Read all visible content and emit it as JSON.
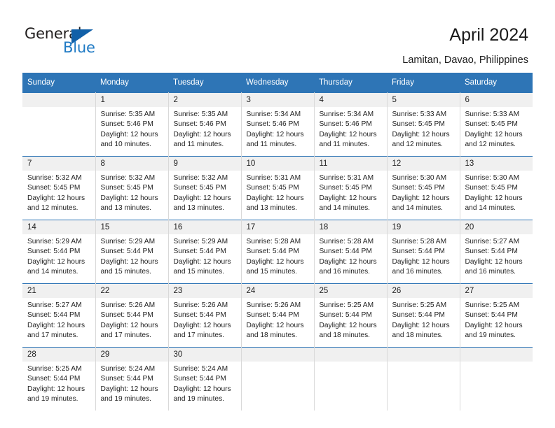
{
  "brand": {
    "name_part1": "General",
    "name_part2": "Blue",
    "triangle_color": "#1160a8"
  },
  "header": {
    "title": "April 2024",
    "subtitle": "Lamitan, Davao, Philippines"
  },
  "theme": {
    "header_blue": "#2e75b6",
    "daynum_band": "#f0f0f0",
    "grid_line": "#d9d9d9"
  },
  "calendar": {
    "weekday_headers": [
      "Sunday",
      "Monday",
      "Tuesday",
      "Wednesday",
      "Thursday",
      "Friday",
      "Saturday"
    ],
    "labels": {
      "sunrise": "Sunrise:",
      "sunset": "Sunset:",
      "daylight": "Daylight:"
    },
    "weeks": [
      [
        {
          "day": "",
          "empty": true,
          "sunrise": "",
          "sunset": "",
          "daylight_line1": "",
          "daylight_line2": ""
        },
        {
          "day": "1",
          "sunrise": "Sunrise: 5:35 AM",
          "sunset": "Sunset: 5:46 PM",
          "daylight_line1": "Daylight: 12 hours",
          "daylight_line2": "and 10 minutes."
        },
        {
          "day": "2",
          "sunrise": "Sunrise: 5:35 AM",
          "sunset": "Sunset: 5:46 PM",
          "daylight_line1": "Daylight: 12 hours",
          "daylight_line2": "and 11 minutes."
        },
        {
          "day": "3",
          "sunrise": "Sunrise: 5:34 AM",
          "sunset": "Sunset: 5:46 PM",
          "daylight_line1": "Daylight: 12 hours",
          "daylight_line2": "and 11 minutes."
        },
        {
          "day": "4",
          "sunrise": "Sunrise: 5:34 AM",
          "sunset": "Sunset: 5:46 PM",
          "daylight_line1": "Daylight: 12 hours",
          "daylight_line2": "and 11 minutes."
        },
        {
          "day": "5",
          "sunrise": "Sunrise: 5:33 AM",
          "sunset": "Sunset: 5:45 PM",
          "daylight_line1": "Daylight: 12 hours",
          "daylight_line2": "and 12 minutes."
        },
        {
          "day": "6",
          "sunrise": "Sunrise: 5:33 AM",
          "sunset": "Sunset: 5:45 PM",
          "daylight_line1": "Daylight: 12 hours",
          "daylight_line2": "and 12 minutes."
        }
      ],
      [
        {
          "day": "7",
          "sunrise": "Sunrise: 5:32 AM",
          "sunset": "Sunset: 5:45 PM",
          "daylight_line1": "Daylight: 12 hours",
          "daylight_line2": "and 12 minutes."
        },
        {
          "day": "8",
          "sunrise": "Sunrise: 5:32 AM",
          "sunset": "Sunset: 5:45 PM",
          "daylight_line1": "Daylight: 12 hours",
          "daylight_line2": "and 13 minutes."
        },
        {
          "day": "9",
          "sunrise": "Sunrise: 5:32 AM",
          "sunset": "Sunset: 5:45 PM",
          "daylight_line1": "Daylight: 12 hours",
          "daylight_line2": "and 13 minutes."
        },
        {
          "day": "10",
          "sunrise": "Sunrise: 5:31 AM",
          "sunset": "Sunset: 5:45 PM",
          "daylight_line1": "Daylight: 12 hours",
          "daylight_line2": "and 13 minutes."
        },
        {
          "day": "11",
          "sunrise": "Sunrise: 5:31 AM",
          "sunset": "Sunset: 5:45 PM",
          "daylight_line1": "Daylight: 12 hours",
          "daylight_line2": "and 14 minutes."
        },
        {
          "day": "12",
          "sunrise": "Sunrise: 5:30 AM",
          "sunset": "Sunset: 5:45 PM",
          "daylight_line1": "Daylight: 12 hours",
          "daylight_line2": "and 14 minutes."
        },
        {
          "day": "13",
          "sunrise": "Sunrise: 5:30 AM",
          "sunset": "Sunset: 5:45 PM",
          "daylight_line1": "Daylight: 12 hours",
          "daylight_line2": "and 14 minutes."
        }
      ],
      [
        {
          "day": "14",
          "sunrise": "Sunrise: 5:29 AM",
          "sunset": "Sunset: 5:44 PM",
          "daylight_line1": "Daylight: 12 hours",
          "daylight_line2": "and 14 minutes."
        },
        {
          "day": "15",
          "sunrise": "Sunrise: 5:29 AM",
          "sunset": "Sunset: 5:44 PM",
          "daylight_line1": "Daylight: 12 hours",
          "daylight_line2": "and 15 minutes."
        },
        {
          "day": "16",
          "sunrise": "Sunrise: 5:29 AM",
          "sunset": "Sunset: 5:44 PM",
          "daylight_line1": "Daylight: 12 hours",
          "daylight_line2": "and 15 minutes."
        },
        {
          "day": "17",
          "sunrise": "Sunrise: 5:28 AM",
          "sunset": "Sunset: 5:44 PM",
          "daylight_line1": "Daylight: 12 hours",
          "daylight_line2": "and 15 minutes."
        },
        {
          "day": "18",
          "sunrise": "Sunrise: 5:28 AM",
          "sunset": "Sunset: 5:44 PM",
          "daylight_line1": "Daylight: 12 hours",
          "daylight_line2": "and 16 minutes."
        },
        {
          "day": "19",
          "sunrise": "Sunrise: 5:28 AM",
          "sunset": "Sunset: 5:44 PM",
          "daylight_line1": "Daylight: 12 hours",
          "daylight_line2": "and 16 minutes."
        },
        {
          "day": "20",
          "sunrise": "Sunrise: 5:27 AM",
          "sunset": "Sunset: 5:44 PM",
          "daylight_line1": "Daylight: 12 hours",
          "daylight_line2": "and 16 minutes."
        }
      ],
      [
        {
          "day": "21",
          "sunrise": "Sunrise: 5:27 AM",
          "sunset": "Sunset: 5:44 PM",
          "daylight_line1": "Daylight: 12 hours",
          "daylight_line2": "and 17 minutes."
        },
        {
          "day": "22",
          "sunrise": "Sunrise: 5:26 AM",
          "sunset": "Sunset: 5:44 PM",
          "daylight_line1": "Daylight: 12 hours",
          "daylight_line2": "and 17 minutes."
        },
        {
          "day": "23",
          "sunrise": "Sunrise: 5:26 AM",
          "sunset": "Sunset: 5:44 PM",
          "daylight_line1": "Daylight: 12 hours",
          "daylight_line2": "and 17 minutes."
        },
        {
          "day": "24",
          "sunrise": "Sunrise: 5:26 AM",
          "sunset": "Sunset: 5:44 PM",
          "daylight_line1": "Daylight: 12 hours",
          "daylight_line2": "and 18 minutes."
        },
        {
          "day": "25",
          "sunrise": "Sunrise: 5:25 AM",
          "sunset": "Sunset: 5:44 PM",
          "daylight_line1": "Daylight: 12 hours",
          "daylight_line2": "and 18 minutes."
        },
        {
          "day": "26",
          "sunrise": "Sunrise: 5:25 AM",
          "sunset": "Sunset: 5:44 PM",
          "daylight_line1": "Daylight: 12 hours",
          "daylight_line2": "and 18 minutes."
        },
        {
          "day": "27",
          "sunrise": "Sunrise: 5:25 AM",
          "sunset": "Sunset: 5:44 PM",
          "daylight_line1": "Daylight: 12 hours",
          "daylight_line2": "and 19 minutes."
        }
      ],
      [
        {
          "day": "28",
          "sunrise": "Sunrise: 5:25 AM",
          "sunset": "Sunset: 5:44 PM",
          "daylight_line1": "Daylight: 12 hours",
          "daylight_line2": "and 19 minutes."
        },
        {
          "day": "29",
          "sunrise": "Sunrise: 5:24 AM",
          "sunset": "Sunset: 5:44 PM",
          "daylight_line1": "Daylight: 12 hours",
          "daylight_line2": "and 19 minutes."
        },
        {
          "day": "30",
          "sunrise": "Sunrise: 5:24 AM",
          "sunset": "Sunset: 5:44 PM",
          "daylight_line1": "Daylight: 12 hours",
          "daylight_line2": "and 19 minutes."
        },
        {
          "day": "",
          "empty": true,
          "sunrise": "",
          "sunset": "",
          "daylight_line1": "",
          "daylight_line2": ""
        },
        {
          "day": "",
          "empty": true,
          "sunrise": "",
          "sunset": "",
          "daylight_line1": "",
          "daylight_line2": ""
        },
        {
          "day": "",
          "empty": true,
          "sunrise": "",
          "sunset": "",
          "daylight_line1": "",
          "daylight_line2": ""
        },
        {
          "day": "",
          "empty": true,
          "sunrise": "",
          "sunset": "",
          "daylight_line1": "",
          "daylight_line2": ""
        }
      ]
    ]
  }
}
